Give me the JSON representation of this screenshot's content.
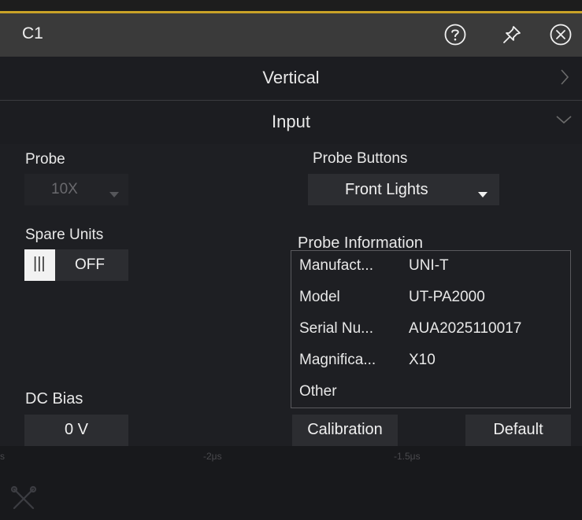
{
  "window": {
    "title": "C1"
  },
  "titlebar": {
    "icons": [
      {
        "name": "help-icon"
      },
      {
        "name": "pin-icon"
      },
      {
        "name": "close-icon"
      }
    ]
  },
  "sections": {
    "vertical": {
      "label": "Vertical",
      "arrow": ">"
    },
    "input": {
      "label": "Input",
      "arrow": "v"
    }
  },
  "probe": {
    "label": "Probe",
    "value": "10X"
  },
  "probe_buttons": {
    "label": "Probe Buttons",
    "value": "Front Lights"
  },
  "spare_units": {
    "label": "Spare Units",
    "toggle_glyph": "|||",
    "value": "OFF"
  },
  "probe_info": {
    "label": "Probe Information",
    "rows": [
      {
        "key": "Manufact...",
        "value": "UNI-T"
      },
      {
        "key": "Model",
        "value": "UT-PA2000"
      },
      {
        "key": "Serial Nu...",
        "value": "AUA2025110017"
      },
      {
        "key": "Magnifica...",
        "value": "X10"
      },
      {
        "key": "Other",
        "value": ""
      }
    ]
  },
  "dc_bias": {
    "label": "DC Bias",
    "value": "0 V"
  },
  "buttons": {
    "calibration": "Calibration",
    "default": "Default"
  },
  "background_axis": {
    "labels": [
      "s",
      "-2μs",
      "-1.5μs"
    ]
  },
  "colors": {
    "accent": "#c9a227",
    "titlebar": "#3a3a3a",
    "panel": "#1e1f23",
    "control": "#2c2d31"
  }
}
